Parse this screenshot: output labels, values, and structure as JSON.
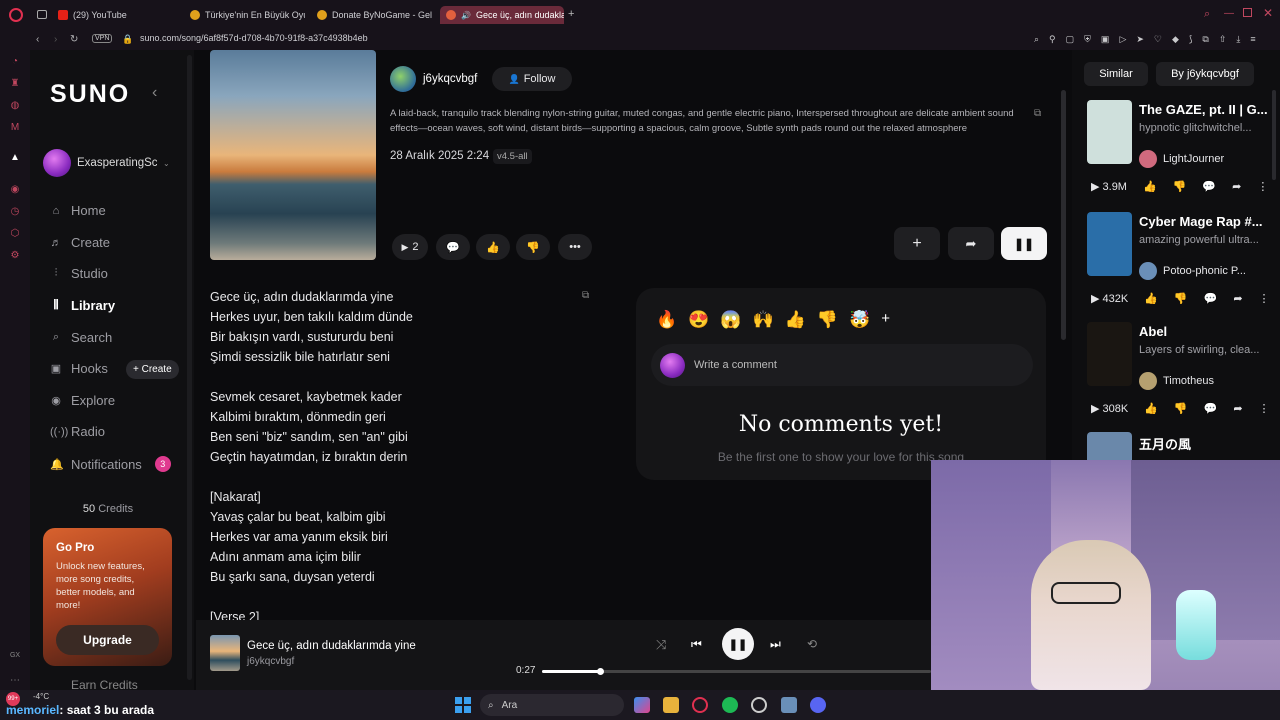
{
  "browser": {
    "tabs": [
      {
        "label": "(29) YouTube"
      },
      {
        "label": "Türkiye'nin En Büyük Oyu"
      },
      {
        "label": "Donate ByNoGame - Gele"
      },
      {
        "label": "Gece üç, adın dudakla"
      }
    ],
    "new_tab": "+",
    "url": "suno.com/song/6af8f57d-d708-4b70-91f8-a37c4938b4eb",
    "vpn": "VPN"
  },
  "sidebar": {
    "logo": "SUNO",
    "collapse_icon": "‹",
    "username": "ExasperatingSc",
    "items": [
      {
        "label": "Home",
        "icon": "home-icon"
      },
      {
        "label": "Create",
        "icon": "create-icon"
      },
      {
        "label": "Studio",
        "icon": "studio-icon"
      },
      {
        "label": "Library",
        "icon": "library-icon"
      },
      {
        "label": "Search",
        "icon": "search-icon"
      },
      {
        "label": "Hooks",
        "icon": "hooks-icon"
      },
      {
        "label": "Explore",
        "icon": "explore-icon"
      },
      {
        "label": "Radio",
        "icon": "radio-icon"
      },
      {
        "label": "Notifications",
        "icon": "bell-icon"
      }
    ],
    "hooks_create": "+ Create",
    "notifications_count": "3",
    "credits_count": "50",
    "credits_label": "Credits",
    "gopro": {
      "title": "Go Pro",
      "body": "Unlock new features, more song credits, better models, and more!",
      "button": "Upgrade"
    },
    "earn_credits": "Earn Credits"
  },
  "song": {
    "artist": "j6ykqcvbgf",
    "follow": "Follow",
    "description": "A laid-back, tranquilo track blending nylon-string guitar, muted congas, and gentle electric piano, Interspersed throughout are delicate ambient sound effects—ocean waves, soft wind, distant birds—supporting a spacious, calm groove, Subtle synth pads round out the relaxed atmosphere",
    "date": "28 Aralık 2025 2:24",
    "version": "v4.5-all",
    "play_count": "2",
    "lyrics": "Gece üç, adın dudaklarımda yine\nHerkes uyur, ben takılı kaldım dünde\nBir bakışın vardı, sustururdu beni\nŞimdi sessizlik bile hatırlatır seni\n\nSevmek cesaret, kaybetmek kader\nKalbimi bıraktım, dönmedin geri\nBen seni \"biz\" sandım, sen \"an\" gibi\nGeçtin hayatımdan, iz bıraktın derin\n\n[Nakarat]\nYavaş çalar bu beat, kalbim gibi\nHerkes var ama yanım eksik biri\nAdını anmam ama içim bilir\nBu şarkı sana, duysan yeterdi\n\n[Verse 2]"
  },
  "comments": {
    "emojis": [
      "🔥",
      "😍",
      "😱",
      "🙌",
      "👍",
      "👎",
      "🤯"
    ],
    "add": "+",
    "placeholder": "Write a comment",
    "empty_title": "No comments yet!",
    "empty_sub": "Be the first one to show your love for this song"
  },
  "right_panel": {
    "tab_similar": "Similar",
    "tab_by": "By j6ykqcvbgf",
    "items": [
      {
        "title": "The GAZE, pt. II | G...",
        "desc": "hypnotic glitchwitchel...",
        "artist": "LightJourner",
        "plays": "3.9M",
        "thumb": "#cfe0dc",
        "avatar": "#d06a7e"
      },
      {
        "title": "Cyber Mage Rap #...",
        "desc": "amazing powerful ultra...",
        "artist": "Potoo-phonic P...",
        "plays": "432K",
        "thumb": "#2a6ea8",
        "avatar": "#6a8fb8"
      },
      {
        "title": "Abel",
        "desc": "Layers of swirling, clea...",
        "artist": "Timotheus",
        "plays": "308K",
        "thumb": "#1a1612",
        "avatar": "#b5a070"
      },
      {
        "title": "五月の風",
        "desc": "",
        "artist": "",
        "plays": "",
        "thumb": "#6a88aa",
        "avatar": "#888"
      }
    ]
  },
  "player": {
    "title": "Gece üç, adın dudaklarımda yine",
    "artist": "j6ykqcvbgf",
    "time": "0:27",
    "progress": 0.15
  },
  "taskbar": {
    "weather": "-4°C",
    "search": "Ara",
    "chat_user": "memoriel",
    "chat_msg": ": saat 3 bu arada",
    "notif_count": "99+"
  }
}
